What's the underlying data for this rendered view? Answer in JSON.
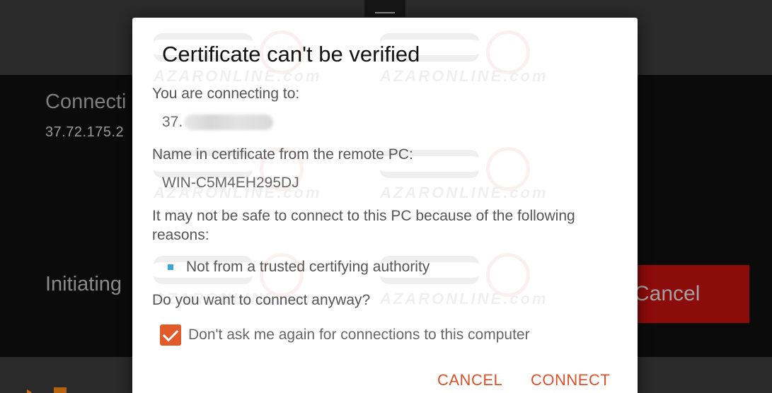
{
  "background": {
    "title": "Connecti",
    "host": "37.72.175.2",
    "status": "Initiating",
    "cancel_label": "Cancel"
  },
  "dialog": {
    "title": "Certificate can't be verified",
    "connecting_label": "You are connecting to:",
    "ip_prefix": "37.",
    "name_label": "Name in certificate from the remote PC:",
    "pc_name": "WIN-C5M4EH295DJ",
    "warning": "It may not be safe to connect to this PC because of the following reasons:",
    "reasons": [
      "Not from a trusted certifying authority"
    ],
    "question": "Do you want to connect anyway?",
    "checkbox_label": "Don't ask me again for connections to this computer",
    "checkbox_checked": true,
    "cancel_button": "CANCEL",
    "connect_button": "CONNECT"
  },
  "watermark": "AZARONLINE.com",
  "colors": {
    "accent": "#e25a2a",
    "button_text": "#d9532a",
    "bullet": "#3aa6d8",
    "background_cancel": "#8c0b0b"
  }
}
